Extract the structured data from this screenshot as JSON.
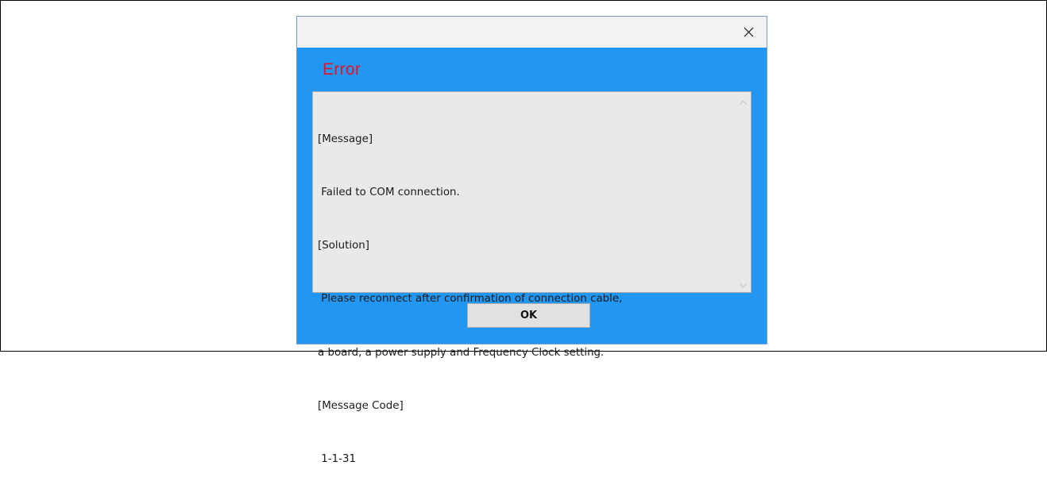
{
  "dialog": {
    "heading": "Error",
    "message_lines": [
      "[Message]",
      " Failed to COM connection.",
      "[Solution]",
      " Please reconnect after confirmation of connection cable,",
      "a board, a power supply and Frequency Clock setting.",
      "[Message Code]",
      " 1-1-31"
    ],
    "ok_label": "OK",
    "close_icon": "close-icon",
    "scroll_up_icon": "chevron-up-icon",
    "scroll_down_icon": "chevron-down-icon"
  },
  "colors": {
    "dialog_background": "#2196f3",
    "heading": "#e81123",
    "message_area": "#e9e9e9",
    "title_bar": "#f2f2f2"
  }
}
